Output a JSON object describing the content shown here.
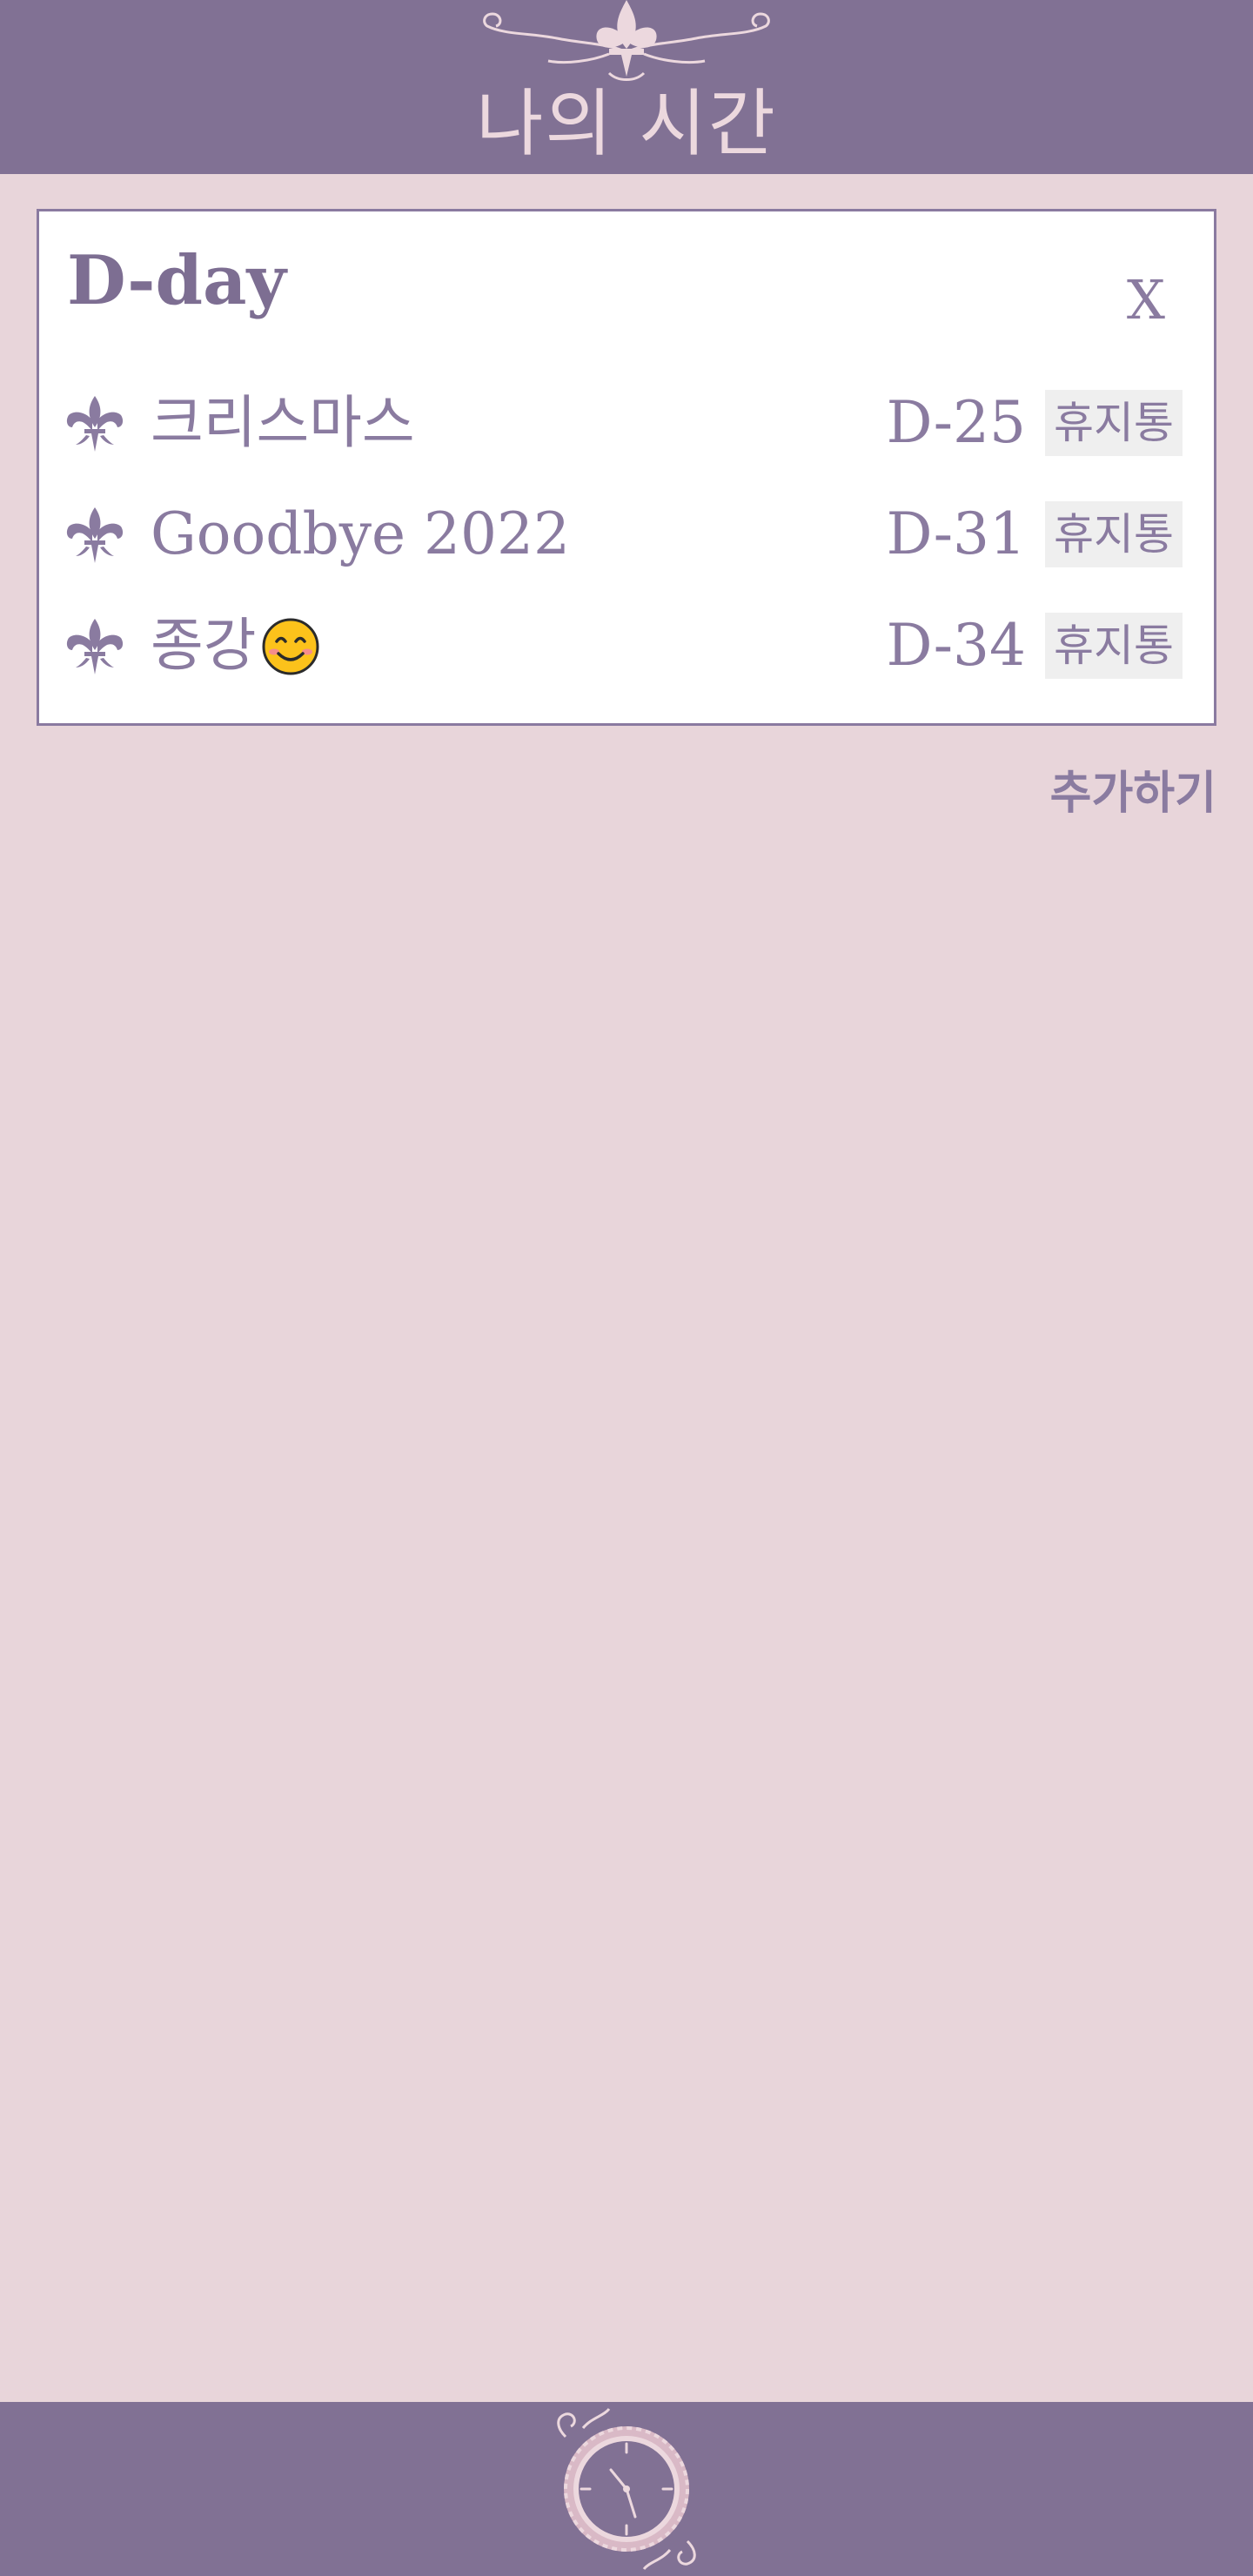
{
  "header": {
    "title": "나의 시간"
  },
  "dday": {
    "title": "D-day",
    "close_label": "X",
    "trash_label": "휴지통",
    "items": [
      {
        "name": "크리스마스",
        "count": "D-25"
      },
      {
        "name": "Goodbye 2022",
        "count": "D-31"
      },
      {
        "name": "종강",
        "count": "D-34",
        "emoji": "smiling-face"
      }
    ]
  },
  "add_button": {
    "label": "추가하기"
  },
  "icons": {
    "header": "fleur-de-lis-ornament-icon",
    "row": "fleur-de-lis-icon",
    "footer": "clock-icon"
  },
  "colors": {
    "bar": "#817194",
    "background": "#e8d5da",
    "accent_text": "#8a7ba0",
    "header_title": "#ecd8de",
    "trash_bg": "#efefef"
  }
}
